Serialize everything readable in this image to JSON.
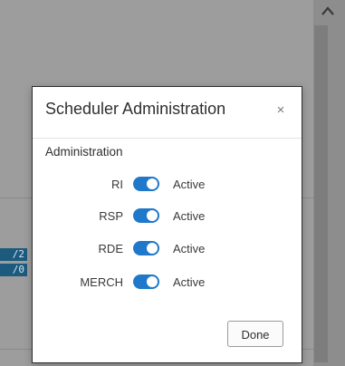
{
  "background": {
    "badges": [
      "/2",
      "/0"
    ]
  },
  "modal": {
    "title": "Scheduler Administration",
    "close_label": "×",
    "section_title": "Administration",
    "rows": [
      {
        "label": "RI",
        "status": "Active",
        "enabled": true
      },
      {
        "label": "RSP",
        "status": "Active",
        "enabled": true
      },
      {
        "label": "RDE",
        "status": "Active",
        "enabled": true
      },
      {
        "label": "MERCH",
        "status": "Active",
        "enabled": true
      }
    ],
    "done_label": "Done"
  },
  "colors": {
    "toggle_on": "#1f78c9",
    "overlay": "#9d9d9d"
  },
  "icons": {
    "close": "close-icon",
    "scroll_up": "chevron-up-icon"
  }
}
